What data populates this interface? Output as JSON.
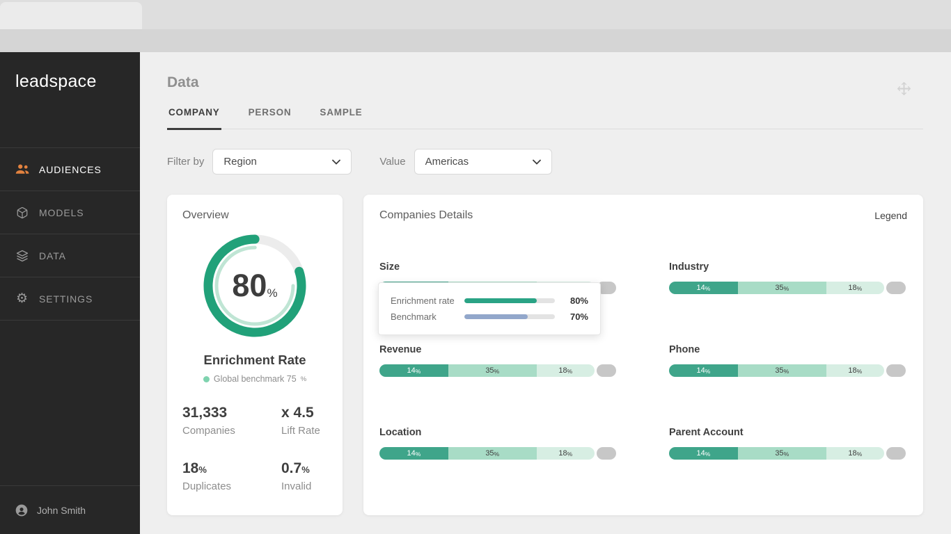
{
  "ui": {
    "pct": "%"
  },
  "sidebar": {
    "logo": "leadspace",
    "items": [
      {
        "label": "AUDIENCES",
        "icon": "people-icon",
        "active": true
      },
      {
        "label": "MODELS",
        "icon": "cube-icon",
        "active": false
      },
      {
        "label": "DATA",
        "icon": "layers-icon",
        "active": false
      },
      {
        "label": "SETTINGS",
        "icon": "gear-icon",
        "active": false
      }
    ],
    "user": "John Smith"
  },
  "header": {
    "title": "Data",
    "tabs": [
      {
        "label": "COMPANY",
        "active": true
      },
      {
        "label": "PERSON",
        "active": false
      },
      {
        "label": "SAMPLE",
        "active": false
      }
    ]
  },
  "filters": {
    "filter_by_label": "Filter by",
    "filter_by_value": "Region",
    "value_label": "Value",
    "value_value": "Americas"
  },
  "overview": {
    "title": "Overview",
    "donut": {
      "percent": 80,
      "benchmark": 75
    },
    "metric_title": "Enrichment Rate",
    "benchmark_text": "Global benchmark 75",
    "stats": [
      {
        "value": "31,333",
        "suffix": "",
        "label": "Companies"
      },
      {
        "value": "x 4.5",
        "suffix": "",
        "label": "Lift Rate"
      },
      {
        "value": "18",
        "suffix": "%",
        "label": "Duplicates"
      },
      {
        "value": "0.7",
        "suffix": "%",
        "label": "Invalid"
      }
    ]
  },
  "details": {
    "title": "Companies Details",
    "legend_label": "Legend",
    "metrics": [
      {
        "name": "Size"
      },
      {
        "name": "Industry"
      },
      {
        "name": "Revenue"
      },
      {
        "name": "Phone"
      },
      {
        "name": "Location"
      },
      {
        "name": "Parent Account"
      }
    ],
    "segments": [
      {
        "label": "14"
      },
      {
        "label": "35"
      },
      {
        "label": "18"
      }
    ],
    "tooltip": {
      "rows": [
        {
          "label": "Enrichment rate",
          "value": "80%",
          "pct": 80,
          "color": "#2aa385"
        },
        {
          "label": "Benchmark",
          "value": "70%",
          "pct": 70,
          "color": "#92a7cb"
        }
      ]
    }
  },
  "colors": {
    "accent_green": "#21a179",
    "segment_dark": "#3fa58a",
    "segment_mid": "#a8dcc6",
    "segment_light": "#d7eee3",
    "segment_gray": "#c7c7c7",
    "benchmark_ring": "#bfe5d4",
    "benchmark_dot": "#7fd3af",
    "audiences_icon_orange": "#e2823f"
  },
  "chart_data": [
    {
      "type": "donut",
      "title": "Enrichment Rate",
      "value": 80,
      "unit": "%",
      "benchmark": 75,
      "annotations": [
        "Global benchmark 75%"
      ]
    },
    {
      "type": "bar",
      "subtype": "stacked-horizontal",
      "categories": [
        "Size",
        "Industry",
        "Revenue",
        "Phone",
        "Location",
        "Parent Account"
      ],
      "series": [
        {
          "name": "segment-1",
          "values": [
            14,
            14,
            14,
            14,
            14,
            14
          ]
        },
        {
          "name": "segment-2",
          "values": [
            35,
            35,
            35,
            35,
            35,
            35
          ]
        },
        {
          "name": "segment-3",
          "values": [
            18,
            18,
            18,
            18,
            18,
            18
          ]
        }
      ],
      "unit": "%"
    },
    {
      "type": "bar",
      "subtype": "tooltip-comparison",
      "categories": [
        "Enrichment rate",
        "Benchmark"
      ],
      "values": [
        80,
        70
      ],
      "unit": "%"
    }
  ]
}
